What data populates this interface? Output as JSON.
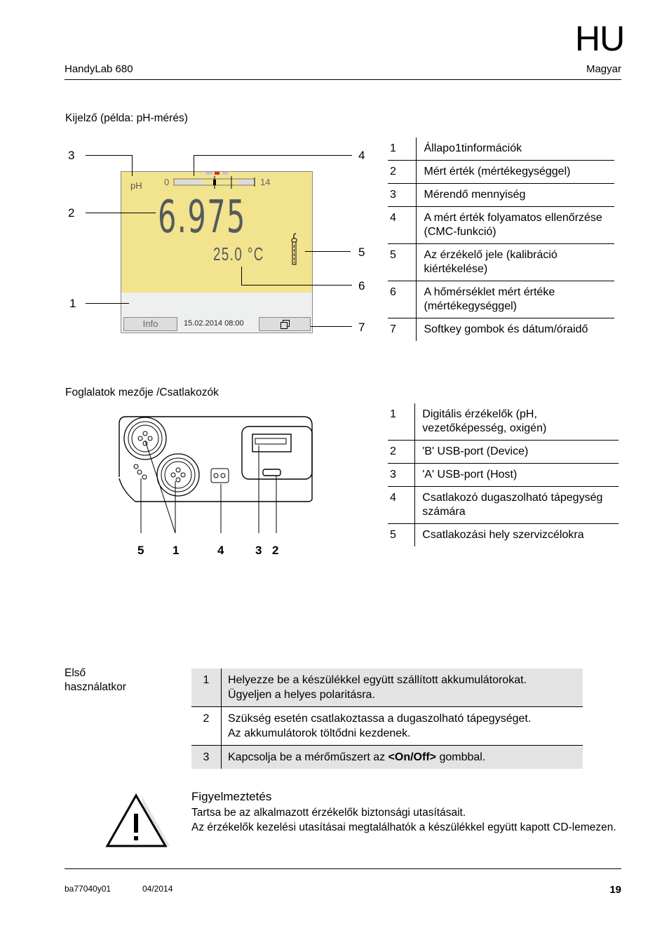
{
  "header": {
    "lang_code": "HU",
    "product": "HandyLab 680",
    "language": "Magyar"
  },
  "display_section": {
    "title": "Kijelző (példa: pH-mérés)",
    "lcd": {
      "parameter": "pH",
      "scale_min": "0",
      "scale_max": "14",
      "value": "6.975",
      "temperature": "25.0 °C",
      "softkey_left": "Info",
      "datetime": "15.02.2014  08:00",
      "softkey_right_icon": "window-stack-icon"
    },
    "callouts": [
      "1",
      "2",
      "3",
      "4",
      "5",
      "6",
      "7"
    ],
    "legend": [
      {
        "num": "1",
        "text": "Állapo1tinformációk"
      },
      {
        "num": "2",
        "text": "Mért érték (mértékegységgel)"
      },
      {
        "num": "3",
        "text": "Mérendő mennyiség"
      },
      {
        "num": "4",
        "text": "A mért érték folyamatos ellenőrzése (CMC-funkció)"
      },
      {
        "num": "5",
        "text": "Az érzékelő jele (kalibráció kiértékelése)"
      },
      {
        "num": "6",
        "text": "A hőmérséklet mért értéke (mértékegységgel)"
      },
      {
        "num": "7",
        "text": "Softkey gombok és dátum/óraidő"
      }
    ]
  },
  "sockets_section": {
    "title": "Foglalatok mezője /Csatlakozók",
    "callouts": [
      "5",
      "1",
      "4",
      "3",
      "2"
    ],
    "legend": [
      {
        "num": "1",
        "text": "Digitális érzékelők (pH, vezetőképesség, oxigén)"
      },
      {
        "num": "2",
        "text": "'B' USB-port (Device)"
      },
      {
        "num": "3",
        "text": "'A' USB-port (Host)"
      },
      {
        "num": "4",
        "text": "Csatlakozó dugaszolható tápegység számára"
      },
      {
        "num": "5",
        "text": "Csatlakozási hely szervizcélokra"
      }
    ]
  },
  "first_use": {
    "label_line1": "Első",
    "label_line2": "használatkor",
    "steps": [
      {
        "num": "1",
        "line1": "Helyezze be a készülékkel együtt szállított akkumulátorokat.",
        "line2": "Ügyeljen a helyes polaritásra."
      },
      {
        "num": "2",
        "line1": "Szükség esetén csatlakoztassa a dugaszolható tápegységet.",
        "line2": "Az akkumulátorok töltődni kezdenek."
      },
      {
        "num": "3",
        "pre": "Kapcsolja be a mérőműszert az ",
        "key": "<On/Off>",
        "post": " gombbal."
      }
    ]
  },
  "warning": {
    "icon": "warning-triangle-icon",
    "title": "Figyelmeztetés",
    "line1": "Tartsa be az alkalmazott érzékelők biztonsági utasításait.",
    "line2": "Az érzékelők kezelési utasításai megtalálhatók a készülékkel együtt kapott CD-lemezen."
  },
  "footer": {
    "doc_id": "ba77040y01",
    "date": "04/2014",
    "page": "19"
  }
}
